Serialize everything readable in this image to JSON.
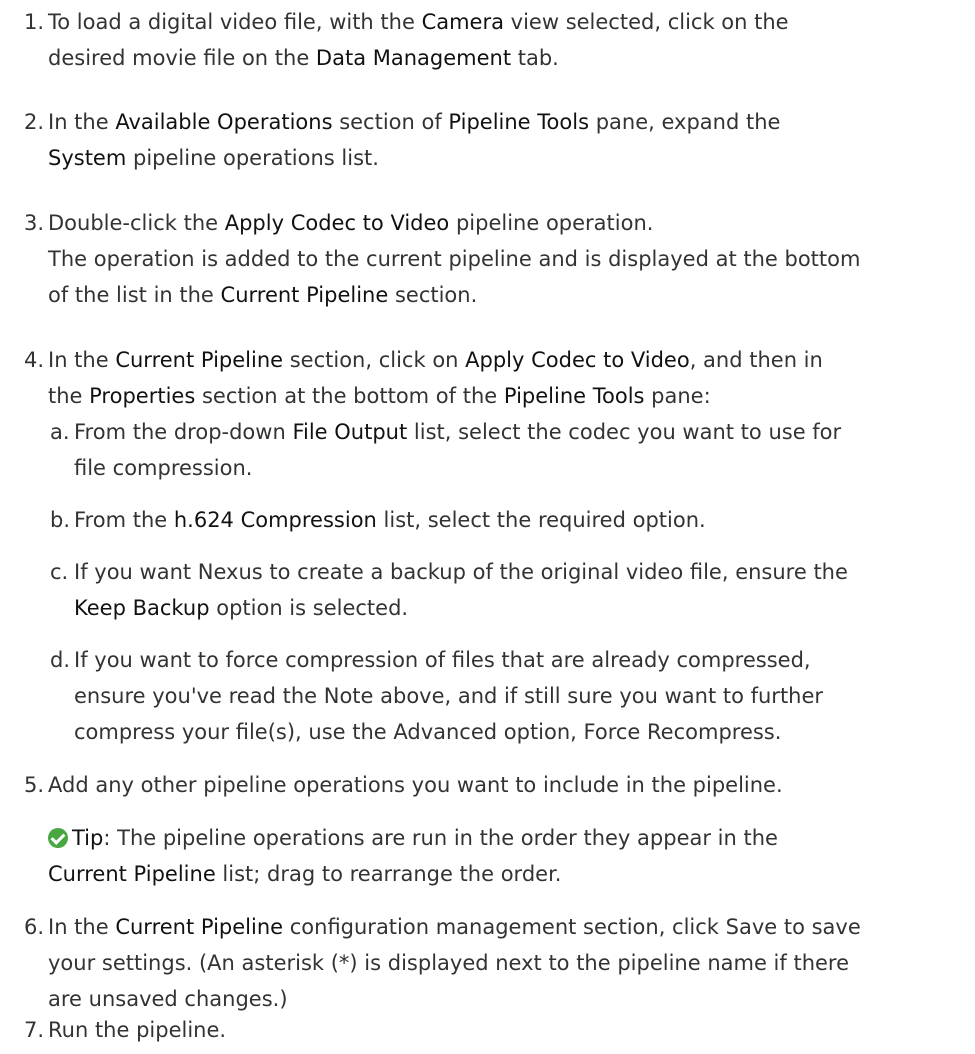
{
  "steps": [
    {
      "num": "1.",
      "l1": [
        "To load a digital video file, with the ",
        "Camera",
        " view selected, click on the"
      ],
      "l2": [
        "desired movie file on the ",
        "Data Management",
        " tab."
      ]
    },
    {
      "num": "2.",
      "l1": [
        "In the ",
        "Available Operations",
        " section of ",
        "Pipeline Tools",
        " pane, expand the"
      ],
      "l2": [
        "System",
        " pipeline operations list."
      ]
    },
    {
      "num": "3.",
      "l1": [
        "Double-click the ",
        "Apply Codec to Video",
        " pipeline operation."
      ],
      "l2": "The operation is added to the current pipeline and is displayed at the bottom",
      "l3": [
        "of the list in the ",
        "Current Pipeline",
        " section."
      ]
    },
    {
      "num": "4.",
      "l1": [
        "In the ",
        "Current Pipeline",
        " section, click on ",
        "Apply Codec to Video",
        ", and then in"
      ],
      "l2": [
        "the ",
        "Properties",
        " section at the bottom of the ",
        "Pipeline Tools",
        " pane:"
      ]
    },
    {
      "num": "a.",
      "l1": [
        "From the drop-down ",
        "File Output",
        " list, select the codec you want to use for"
      ],
      "l2": "file compression."
    },
    {
      "num": "b.",
      "l1": [
        "From the ",
        "h.624 Compression",
        " list, select the required option."
      ]
    },
    {
      "num": "c.",
      "l1": "If you want Nexus to create a backup of the original video file, ensure the",
      "l2": [
        "Keep Backup",
        " option is selected."
      ]
    },
    {
      "num": "d.",
      "l1": "If you want to force compression of files that are already compressed,",
      "l2": "ensure you've read the Note above, and if still sure you want to further",
      "l3": "compress your file(s), use the Advanced option, Force Recompress."
    },
    {
      "num": "5.",
      "l1": "Add any other pipeline operations you want to include in the pipeline."
    },
    {
      "num": "6.",
      "l1": [
        "In the ",
        "Current Pipeline",
        " configuration management section, click Save to save"
      ],
      "l2": "your settings. (An asterisk (*) is displayed next to the pipeline name if there",
      "l3": "are unsaved changes.)"
    },
    {
      "num": "7.",
      "l1": "Run the pipeline."
    }
  ],
  "tip": {
    "icon": "check-circle-icon",
    "label": "Tip",
    "l1_rest": ": The pipeline operations are run in the order they appear in the",
    "l2": [
      "Current Pipeline",
      " list; drag to rearrange the order."
    ]
  },
  "colors": {
    "text": "#333333",
    "tip_icon": "#49a741"
  }
}
